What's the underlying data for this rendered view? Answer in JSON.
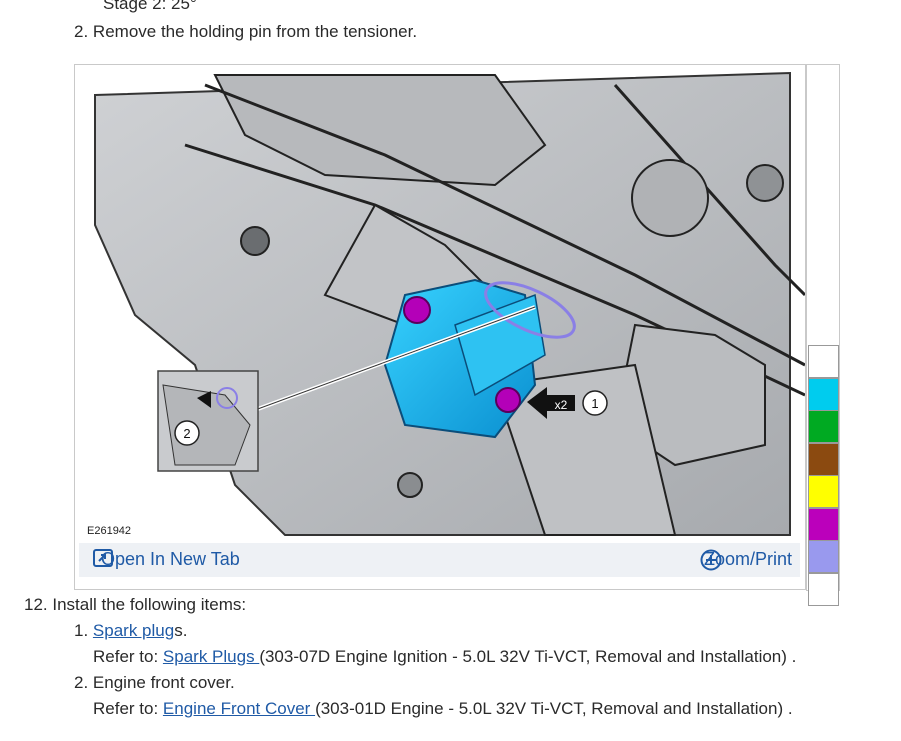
{
  "top_partial": "Stage 2:  25°",
  "steps": {
    "step2": {
      "num": "2.",
      "text": "Remove the holding pin from the tensioner."
    },
    "step12": {
      "num": "12.",
      "text": "Install the following items:"
    },
    "items": [
      {
        "num": "1.",
        "link": "Spark plug",
        "after": "s.",
        "refer_label": "Refer to: ",
        "refer_link": "Spark Plugs ",
        "refer_rest": "(303-07D Engine Ignition - 5.0L 32V Ti-VCT, Removal and Installation) ."
      },
      {
        "num": "2.",
        "text": "Engine front cover.",
        "refer_label": "Refer to: ",
        "refer_link": "Engine Front Cover ",
        "refer_rest": "(303-01D Engine - 5.0L 32V Ti-VCT, Removal and Installation) ."
      }
    ]
  },
  "figure": {
    "id": "E261942",
    "callout1": "1",
    "callout2": "2",
    "arrow_label": "x2",
    "open_label": "Open In New Tab",
    "zoom_label": "Zoom/Print",
    "open_icon": "open-in-new-tab-icon",
    "zoom_icon": "plus-circle-icon"
  },
  "legend_colors": [
    "#ffffff",
    "#00ccee",
    "#00aa22",
    "#8b4a10",
    "#ffff00",
    "#bb00bb",
    "#9999ee",
    "#ffffff"
  ]
}
